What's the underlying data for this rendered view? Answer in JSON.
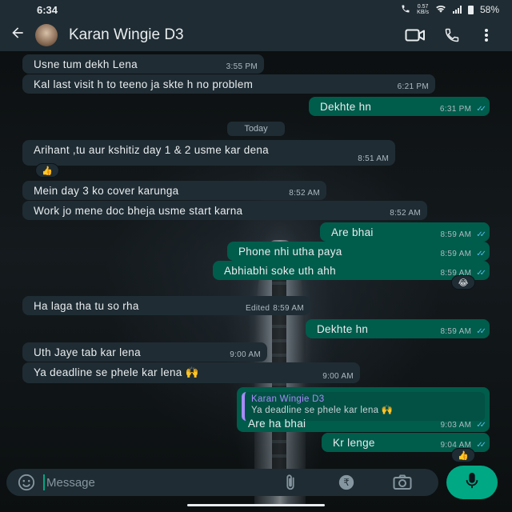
{
  "status_bar": {
    "time": "6:34",
    "net_speed_value": "0.57",
    "net_speed_unit": "KB/s",
    "battery": "58%"
  },
  "header": {
    "contact_name": "Karan Wingie D3"
  },
  "day_chip": "Today",
  "messages": [
    {
      "text": "Usne tum dekh Lena",
      "time": "3:55 PM"
    },
    {
      "text": "Kal last visit h to teeno ja skte h no problem",
      "time": "6:21 PM"
    },
    {
      "text": "Dekhte hn",
      "time": "6:31 PM"
    },
    {
      "text": "Arihant ,tu aur kshitiz day 1 & 2 usme kar dena",
      "time": "8:51 AM",
      "reaction": "👍"
    },
    {
      "text": "Mein day 3 ko cover karunga",
      "time": "8:52 AM"
    },
    {
      "text": "Work jo mene doc bheja usme start karna",
      "time": "8:52 AM"
    },
    {
      "text": "Are bhai",
      "time": "8:59 AM"
    },
    {
      "text": "Phone nhi utha paya",
      "time": "8:59 AM"
    },
    {
      "text": "Abhiabhi soke uth ahh",
      "time": "8:59 AM",
      "reaction": "😂"
    },
    {
      "text": "Ha laga tha tu so rha",
      "time": "8:59 AM",
      "edited": "Edited"
    },
    {
      "text": "Dekhte hn",
      "time": "8:59 AM"
    },
    {
      "text": "Uth Jaye tab kar lena",
      "time": "9:00 AM"
    },
    {
      "text": "Ya deadline se phele kar lena 🙌",
      "time": "9:00 AM"
    },
    {
      "text": "Are ha bhai",
      "time": "9:03 AM",
      "quote_name": "Karan Wingie D3",
      "quote_text": "Ya deadline se phele kar lena 🙌"
    },
    {
      "text": "Kr lenge",
      "time": "9:04 AM",
      "reaction": "👍"
    }
  ],
  "input": {
    "placeholder": "Message"
  },
  "colors": {
    "outgoing_bubble": "#005c4b",
    "incoming_bubble": "#1f2c33",
    "accent": "#00a884",
    "read_ticks": "#53bdeb"
  },
  "icons": [
    "back-arrow-icon",
    "video-call-icon",
    "phone-icon",
    "more-options-icon",
    "emoji-icon",
    "attach-icon",
    "rupee-icon",
    "camera-icon",
    "mic-icon"
  ]
}
